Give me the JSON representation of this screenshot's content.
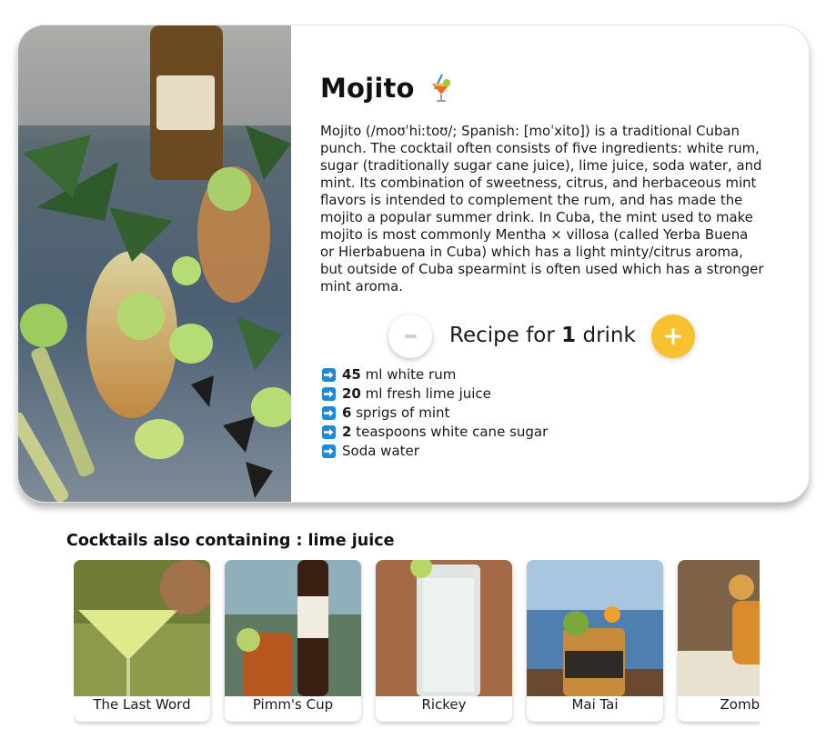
{
  "cocktail": {
    "name": "Mojito",
    "emoji_icon": "tropical-drink-icon",
    "description": "Mojito (/moʊˈhiːtoʊ/; Spanish: [moˈxito]) is a traditional Cuban punch. The cocktail often consists of five ingredients: white rum, sugar (traditionally sugar cane juice), lime juice, soda water, and mint. Its combination of sweetness, citrus, and herbaceous mint flavors is intended to complement the rum, and has made the mojito a popular summer drink. In Cuba, the mint used to make mojito is most commonly Mentha × villosa (called Yerba Buena or Hierbabuena in Cuba) which has a light minty/citrus aroma, but outside of Cuba spearmint is often used which has a stronger mint aroma."
  },
  "recipe": {
    "prefix": "Recipe for",
    "count": "1",
    "suffix": "drink",
    "accent_color": "#f8c131"
  },
  "ingredients": [
    {
      "qty": "45",
      "text": "ml white rum"
    },
    {
      "qty": "20",
      "text": "ml fresh lime juice"
    },
    {
      "qty": "6",
      "text": "sprigs of mint"
    },
    {
      "qty": "2",
      "text": "teaspoons white cane sugar"
    },
    {
      "qty": "",
      "text": "Soda water"
    }
  ],
  "related": {
    "title": "Cocktails also containing : lime juice",
    "items": [
      {
        "name": "The Last Word"
      },
      {
        "name": "Pimm's Cup"
      },
      {
        "name": "Rickey"
      },
      {
        "name": "Mai Tai"
      },
      {
        "name": "Zombie"
      }
    ]
  }
}
